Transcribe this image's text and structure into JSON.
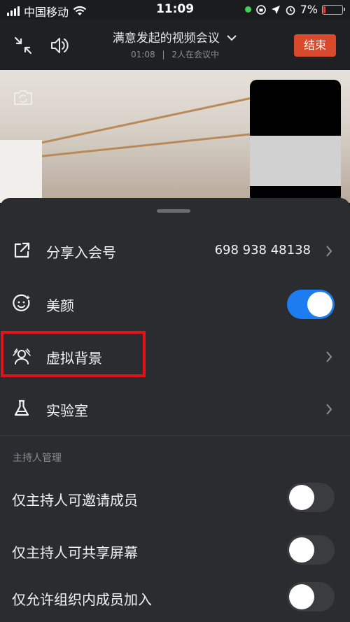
{
  "status_bar": {
    "carrier": "中国移动",
    "time": "11:09",
    "battery": "7%"
  },
  "header": {
    "title": "满意发起的视频会议",
    "duration": "01:08",
    "separator": "|",
    "participants": "2人在会议中",
    "end_label": "结束"
  },
  "menu": {
    "share": {
      "label": "分享入会号",
      "value": "698 938 48138"
    },
    "beauty": {
      "label": "美颜",
      "enabled": true
    },
    "virtual_bg": {
      "label": "虚拟背景"
    },
    "lab": {
      "label": "实验室"
    }
  },
  "host": {
    "section_title": "主持人管理",
    "items": [
      {
        "label": "仅主持人可邀请成员",
        "enabled": false
      },
      {
        "label": "仅主持人可共享屏幕",
        "enabled": false
      },
      {
        "label": "仅允许组织内成员加入",
        "enabled": false
      }
    ]
  },
  "colors": {
    "toggle_on": "#1d7df0",
    "end_button": "#d9492b",
    "highlight": "#e0131a"
  }
}
